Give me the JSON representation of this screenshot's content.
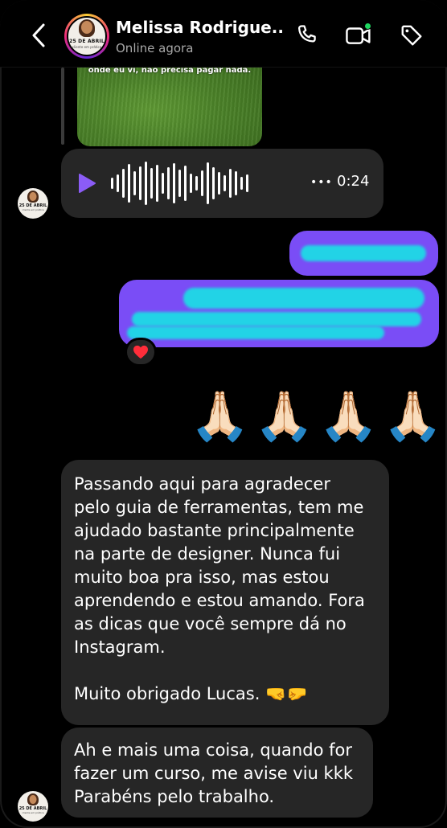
{
  "header": {
    "contact_name": "Melissa Rodrigue...",
    "status": "Online agora",
    "avatar_date_text": "25 DE ABRIL",
    "avatar_caption_text": "cliente em prática",
    "back_icon": "chevron-left-icon",
    "phone_icon": "phone-icon",
    "video_icon": "video-camera-icon",
    "tag_icon": "tag-icon",
    "online_color": "#1ed760"
  },
  "thread": {
    "photo_caption": "onde eu vi, não precisa pagar nada.",
    "audio": {
      "duration": "0:24",
      "play_color": "#8b5cf6"
    },
    "reaction_emoji": "❤️",
    "emoji_message": [
      "🙏🏻",
      "🙏🏻",
      "🙏🏻",
      "🙏🏻"
    ],
    "incoming_1_lines": [
      "Passando aqui para agradecer",
      "pelo guia de ferramentas, tem me",
      "ajudado bastante principalmente",
      "na parte de designer. Nunca fui",
      "muito boa pra isso, mas estou",
      "aprendendo e estou amando. Fora",
      "as dicas que você sempre dá no",
      "Instagram.",
      "",
      "Muito obrigado Lucas. 🤜🤛"
    ],
    "incoming_2_lines": [
      "Ah e mais uma coisa, quando for",
      "fazer um curso, me avise viu kkk",
      "Parabéns pelo trabalho."
    ]
  },
  "colors": {
    "background": "#000000",
    "incoming_bubble": "#262626",
    "outgoing_bubble": "#7a4df6",
    "redaction": "#22d3e6"
  }
}
